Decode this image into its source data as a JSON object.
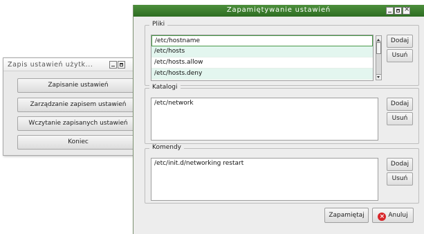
{
  "back_window": {
    "title": "Zapis ustawień użytk...",
    "buttons": [
      "Zapisanie ustawień",
      "Zarządzanie zapisem ustawień",
      "Wczytanie zapisanych ustawień",
      "Koniec"
    ]
  },
  "dialog": {
    "title": "Zapamiętywanie ustawień",
    "groups": {
      "files": {
        "label": "Pliki",
        "items": [
          "/etc/hostname",
          "/etc/hosts",
          "/etc/hosts.allow",
          "/etc/hosts.deny"
        ],
        "add_label": "Dodaj",
        "remove_label": "Usuń"
      },
      "directories": {
        "label": "Katalogi",
        "items": [
          "/etc/network"
        ],
        "add_label": "Dodaj",
        "remove_label": "Usuń"
      },
      "commands": {
        "label": "Komendy",
        "items": [
          "/etc/init.d/networking restart"
        ],
        "add_label": "Dodaj",
        "remove_label": "Usuń"
      }
    },
    "save_label": "Zapamiętaj",
    "cancel_label": "Anuluj"
  },
  "colors": {
    "titlebar_green": "#3d7f2f",
    "row_alt": "#e3f6ef",
    "cancel_icon": "#d8262a"
  }
}
